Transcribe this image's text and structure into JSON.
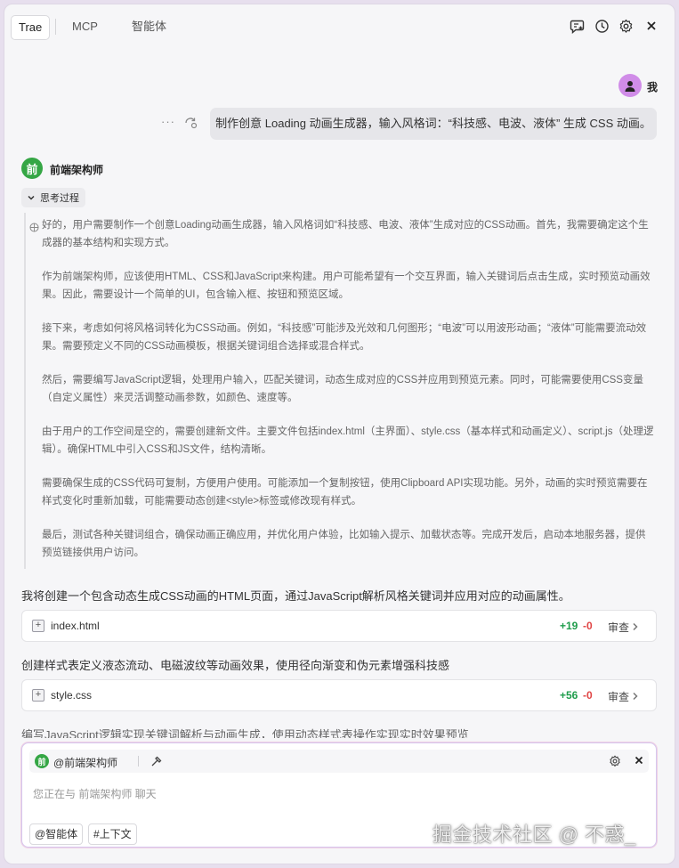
{
  "tabs": [
    {
      "label": "Trae"
    },
    {
      "label": "MCP"
    },
    {
      "label": "智能体"
    }
  ],
  "toolbar_icons": [
    "new-chat-icon",
    "history-icon",
    "settings-icon",
    "close-icon"
  ],
  "conversation": {
    "user_label": "我",
    "user_message": "制作创意 Loading 动画生成器，输入风格词：“科技感、电波、液体” 生成 CSS 动画。",
    "more_label": "···",
    "assistant_name": "前端架构师",
    "assistant_avatar_char": "前",
    "thinking": {
      "label": "思考过程",
      "paragraphs": [
        "好的，用户需要制作一个创意Loading动画生成器，输入风格词如“科技感、电波、液体”生成对应的CSS动画。首先，我需要确定这个生成器的基本结构和实现方式。",
        "作为前端架构师，应该使用HTML、CSS和JavaScript来构建。用户可能希望有一个交互界面，输入关键词后点击生成，实时预览动画效果。因此，需要设计一个简单的UI，包含输入框、按钮和预览区域。",
        "接下来，考虑如何将风格词转化为CSS动画。例如，“科技感”可能涉及光效和几何图形；“电波”可以用波形动画；“液体”可能需要流动效果。需要预定义不同的CSS动画模板，根据关键词组合选择或混合样式。",
        "然后，需要编写JavaScript逻辑，处理用户输入，匹配关键词，动态生成对应的CSS并应用到预览元素。同时，可能需要使用CSS变量（自定义属性）来灵活调整动画参数，如颜色、速度等。",
        "由于用户的工作空间是空的，需要创建新文件。主要文件包括index.html（主界面）、style.css（基本样式和动画定义）、script.js（处理逻辑）。确保HTML中引入CSS和JS文件，结构清晰。",
        "需要确保生成的CSS代码可复制，方便用户使用。可能添加一个复制按钮，使用Clipboard API实现功能。另外，动画的实时预览需要在样式变化时重新加载，可能需要动态创建<style>标签或修改现有样式。",
        "最后，测试各种关键词组合，确保动画正确应用，并优化用户体验，比如输入提示、加载状态等。完成开发后，启动本地服务器，提供预览链接供用户访问。"
      ]
    },
    "intro": "我将创建一个包含动态生成CSS动画的HTML页面，通过JavaScript解析风格关键词并应用对应的动画属性。",
    "files": [
      {
        "name": "index.html",
        "added": "+19",
        "removed": "-0",
        "review": "审查"
      },
      {
        "name": "style.css",
        "added": "+56",
        "removed": "-0",
        "review": "审查"
      }
    ],
    "step2": "创建样式表定义液态流动、电磁波纹等动画效果，使用径向渐变和伪元素增强科技感",
    "step3": "编写JavaScript逻辑实现关键词解析与动画生成，使用动态样式表操作实现实时效果预览"
  },
  "input": {
    "agent_mention": "@前端架构师",
    "placeholder": "您正在与 前端架构师 聊天",
    "chip_agent": "@智能体",
    "chip_context": "#上下文"
  },
  "watermark": "掘金技术社区 @ 不惑_",
  "colors": {
    "accent_green": "#35a645",
    "added": "#1f9d4c",
    "removed": "#e04545",
    "avatar": "#d08ce8"
  }
}
